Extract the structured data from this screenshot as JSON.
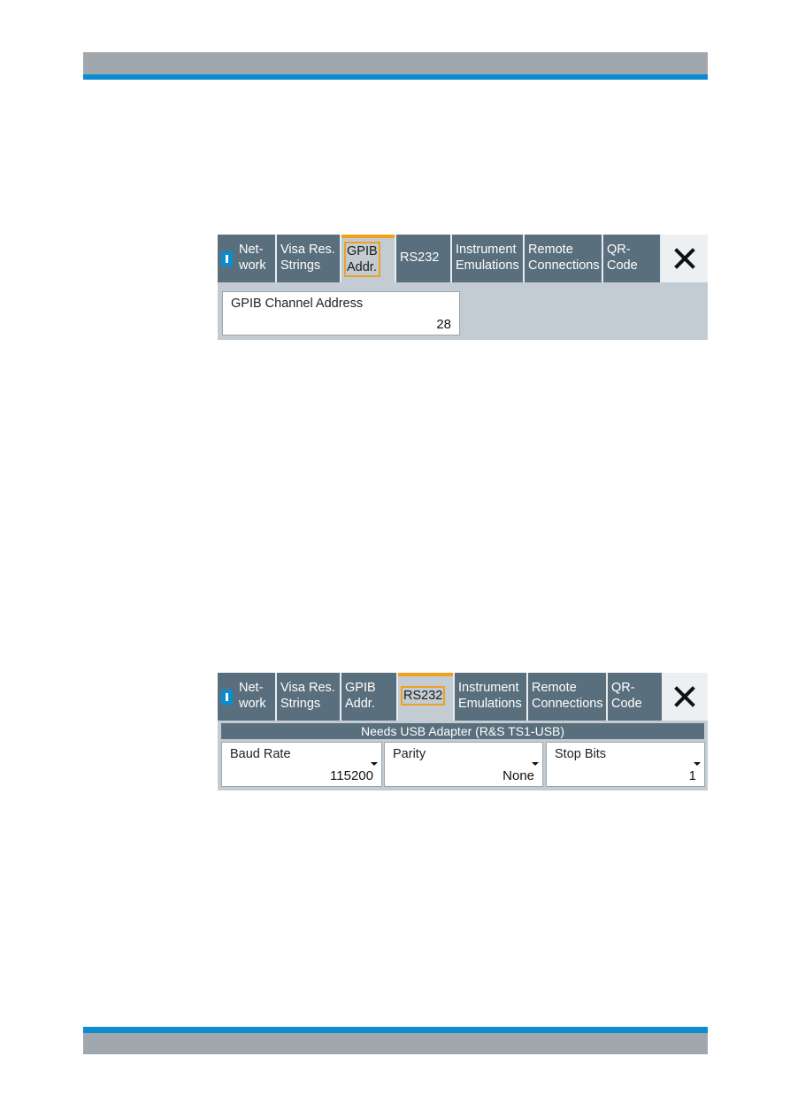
{
  "colors": {
    "header_gray": "#a0a8ad",
    "brand_blue": "#0b8bd0",
    "tab_bg": "#5a6f7d",
    "active_accent": "#f0a020",
    "panel_bg": "#c3ccd2"
  },
  "dialog1": {
    "tabs": [
      {
        "label": "Net-\nwork",
        "icon": "info-icon"
      },
      {
        "label": "Visa Res.\nStrings"
      },
      {
        "label": "GPIB\nAddr.",
        "active": true
      },
      {
        "label": "RS232"
      },
      {
        "label": "Instrument\nEmulations"
      },
      {
        "label": "Remote\nConnections"
      },
      {
        "label": "QR-\nCode"
      }
    ],
    "close_icon": "close-icon",
    "fields": [
      {
        "label": "GPIB Channel Address",
        "value": "28"
      }
    ]
  },
  "dialog2": {
    "tabs": [
      {
        "label": "Net-\nwork",
        "icon": "info-icon"
      },
      {
        "label": "Visa Res.\nStrings"
      },
      {
        "label": "GPIB\nAddr."
      },
      {
        "label": "RS232",
        "active": true
      },
      {
        "label": "Instrument\nEmulations"
      },
      {
        "label": "Remote\nConnections"
      },
      {
        "label": "QR-\nCode"
      }
    ],
    "close_icon": "close-icon",
    "banner": "Needs USB Adapter (R&S TS1-USB)",
    "fields": [
      {
        "label": "Baud Rate",
        "value": "115200"
      },
      {
        "label": "Parity",
        "value": "None"
      },
      {
        "label": "Stop Bits",
        "value": "1"
      }
    ]
  }
}
